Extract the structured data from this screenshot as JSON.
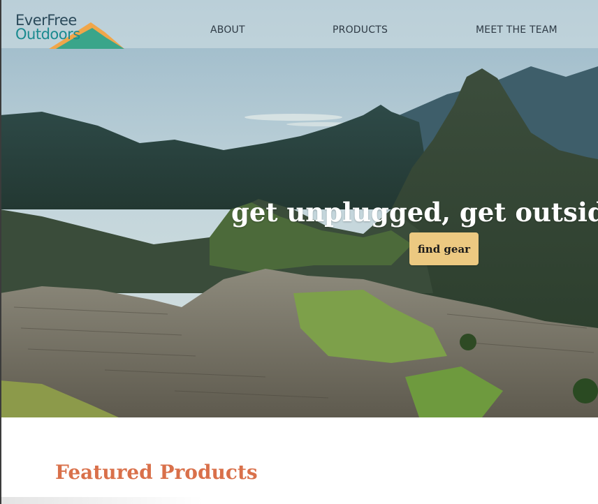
{
  "header": {
    "logo": {
      "line1": "EverFree",
      "line2": "Outdoors"
    },
    "nav": [
      {
        "label": "ABOUT"
      },
      {
        "label": "PRODUCTS"
      },
      {
        "label": "MEET THE TEAM"
      }
    ]
  },
  "hero": {
    "tagline": "get unplugged, get outside, get",
    "cta_label": "find gear"
  },
  "featured": {
    "title": "Featured Products"
  },
  "colors": {
    "accent": "#d9704a",
    "cta": "#ecc981",
    "logo_dark": "#2b4a5a",
    "logo_teal": "#1a8a8f"
  }
}
